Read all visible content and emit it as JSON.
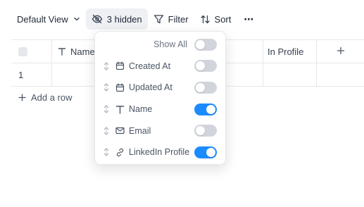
{
  "toolbar": {
    "view_label": "Default View",
    "hidden_label": "3 hidden",
    "filter_label": "Filter",
    "sort_label": "Sort",
    "more_label": "⋯"
  },
  "table": {
    "headers": {
      "name": "Name",
      "linkedin": "In Profile"
    },
    "rows": [
      {
        "index": "1"
      }
    ],
    "add_column_label": "+"
  },
  "add_row_label": "Add a row",
  "fields_popover": {
    "show_all_label": "Show All",
    "fields": [
      {
        "label": "Created At",
        "icon": "calendar-icon",
        "visible": false
      },
      {
        "label": "Updated At",
        "icon": "calendar-icon",
        "visible": false
      },
      {
        "label": "Name",
        "icon": "text-type-icon",
        "visible": true
      },
      {
        "label": "Email",
        "icon": "mail-icon",
        "visible": false
      },
      {
        "label": "LinkedIn Profile",
        "icon": "link-icon",
        "visible": true
      }
    ]
  },
  "colors": {
    "toggle_on": "#1a8cff",
    "toggle_off": "#d1d5db",
    "border": "#e5e7eb"
  }
}
